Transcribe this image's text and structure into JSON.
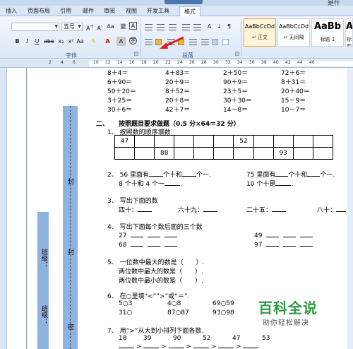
{
  "titlebar": {
    "right_text": "是什"
  },
  "tabs": [
    "插入",
    "页面布局",
    "引用",
    "邮件",
    "审阅",
    "视图",
    "开发工具",
    "格式"
  ],
  "font": {
    "size_value": "五号"
  },
  "groups": {
    "font_label": "字体",
    "paragraph_label": "段落"
  },
  "styles": [
    {
      "sample": "AaBbCcDd",
      "name": "↵ 正文"
    },
    {
      "sample": "AaBbCcDd",
      "name": "↵ 无间隔"
    },
    {
      "sample": "AaBb",
      "name": "标题 1"
    },
    {
      "sample": "AaB",
      "name": "标题"
    }
  ],
  "ruler": {
    "marks": [
      "2",
      "4",
      "6",
      "10",
      "12",
      "14",
      "16",
      "18",
      "20",
      "22",
      "24",
      "26",
      "28",
      "30",
      "32",
      "34",
      "36",
      "38",
      "40",
      "42",
      "44",
      "46"
    ]
  },
  "margin_labels": {
    "seal": "封",
    "seal2": "封",
    "seal3": "密",
    "class": "班级：",
    "name": "班级："
  },
  "top_rows": [
    [
      "8＋4＝",
      "4＋83＝",
      "2＋50＝",
      "72＋6＝"
    ],
    [
      "6＋90＝",
      "20＋9＝",
      "90＋9＝",
      "8＋31＝"
    ],
    [
      "50＋20＝",
      "8＋52＝",
      "23＋5＝",
      "20＋40＝"
    ],
    [
      "3＋25＝",
      "20＋8＝",
      "30＋30＝",
      "15－9＝"
    ],
    [
      "30＋6＝",
      "42＋7＝",
      "14－8＝",
      "10－7＝"
    ]
  ],
  "section2": {
    "title_num": "二、",
    "title": "按照题目要求做题（0.5 分×64＝32 分）",
    "q1": "1、 按照数的顺序填数",
    "table_row1": [
      "47",
      "",
      "",
      "",
      "",
      "",
      "52",
      "",
      "",
      "",
      ""
    ],
    "table_row2": [
      "",
      "",
      "88",
      "",
      "",
      "",
      "",
      "",
      "93",
      "",
      ""
    ],
    "q2a": "2、 56 里面有",
    "q2a_mid": "个十和",
    "q2a_end": "个一.",
    "q2b": "75 里面有",
    "q2b_mid": "个十和",
    "q2b_end": "个一.",
    "q2c": "8 个十和 4 个一",
    "q2c_end": ".",
    "q2d": "10 个十是",
    "q2d_end": ".",
    "q3": "3、 写出下面的数",
    "q3_items": [
      "四十：",
      "六十九：",
      "二十五：",
      "八十："
    ],
    "q4": "4、 写出下面每个数后面的三个数",
    "q4_nums": [
      "27",
      "68",
      "49",
      "97"
    ],
    "q5_lines": [
      "5、 一位数中最大的数是（　　）.",
      "两位数中最大的数是（　　）.",
      "两位数中最小的数是（　　）."
    ],
    "q6": "6、 在○里填“<”“>”或“＝”.",
    "q6_items": [
      "5○3",
      "4○8",
      "69○59",
      "31○",
      "87○87",
      "93○98"
    ],
    "q7": "7、 用“>”从大到小排列下面各数.",
    "q7_nums": [
      "18",
      "39",
      "90",
      "52",
      "47",
      "53"
    ],
    "q7_sep": ">"
  },
  "watermark": {
    "logo": "百科全说",
    "sub": "助你轻松解决"
  }
}
